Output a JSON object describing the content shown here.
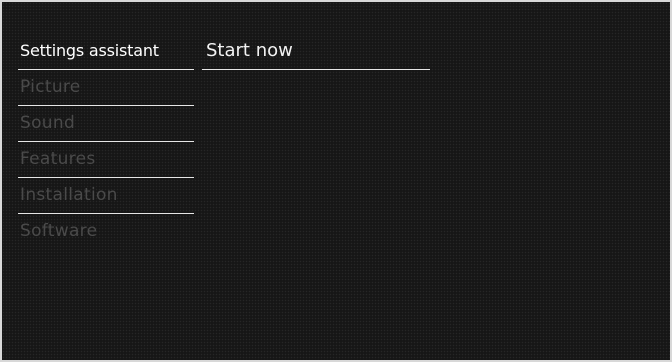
{
  "menu": {
    "items": [
      {
        "label": "Settings assistant"
      },
      {
        "label": "Picture"
      },
      {
        "label": "Sound"
      },
      {
        "label": "Features"
      },
      {
        "label": "Installation"
      },
      {
        "label": "Software"
      }
    ],
    "selected": "Settings assistant"
  },
  "submenu": {
    "items": [
      {
        "label": "Start now"
      }
    ]
  },
  "colors": {
    "background": "#161616",
    "active_text": "#ffffff",
    "inactive_text": "#4a4a4a",
    "divider": "#e6e6e6"
  }
}
